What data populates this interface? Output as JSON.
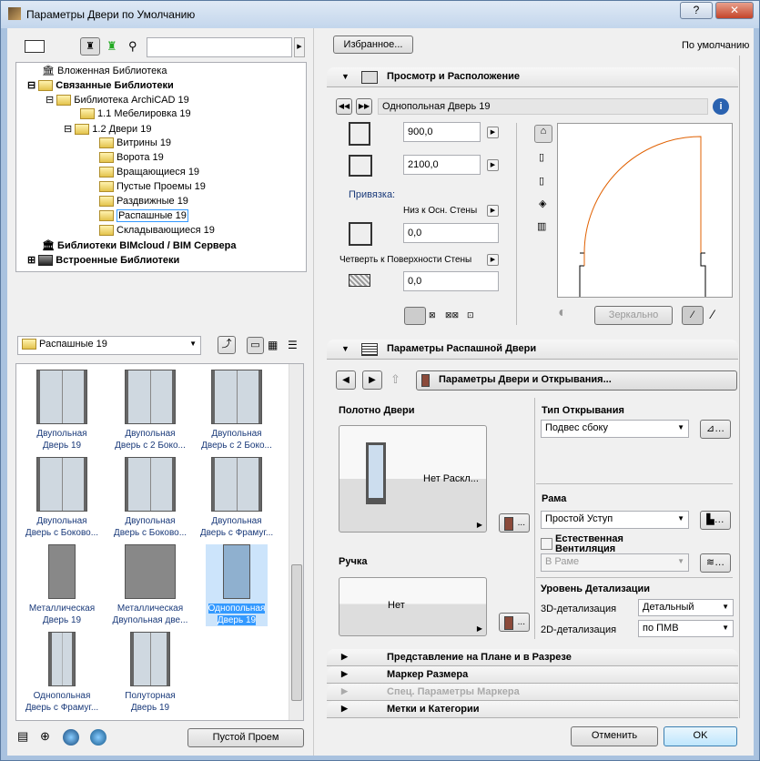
{
  "window": {
    "title": "Параметры Двери по Умолчанию",
    "help": "?",
    "close": "✕"
  },
  "left": {
    "tree": [
      {
        "label": "Вложенная Библиотека",
        "bold": false
      },
      {
        "label": "Связанные Библиотеки",
        "bold": true
      },
      {
        "label": "Библиотека ArchiCAD 19",
        "bold": false
      },
      {
        "label": "1.1 Мебелировка 19",
        "bold": false
      },
      {
        "label": "1.2 Двери 19",
        "bold": false
      },
      {
        "label": "Витрины 19",
        "bold": false
      },
      {
        "label": "Ворота 19",
        "bold": false
      },
      {
        "label": "Вращающиеся 19",
        "bold": false
      },
      {
        "label": "Пустые Проемы 19",
        "bold": false
      },
      {
        "label": "Раздвижные 19",
        "bold": false
      },
      {
        "label": "Распашные 19",
        "bold": false,
        "selected": true
      },
      {
        "label": "Складывающиеся 19",
        "bold": false
      },
      {
        "label": "Библиотеки BIMcloud / BIM Сервера",
        "bold": true
      },
      {
        "label": "Встроенные Библиотеки",
        "bold": true
      }
    ],
    "folder_select": "Распашные 19",
    "items": [
      {
        "l1": "Двупольная",
        "l2": "Дверь 19"
      },
      {
        "l1": "Двупольная",
        "l2": "Дверь с 2 Боко..."
      },
      {
        "l1": "Двупольная",
        "l2": "Дверь с 2 Боко..."
      },
      {
        "l1": "Двупольная",
        "l2": "Дверь с Боково..."
      },
      {
        "l1": "Двупольная",
        "l2": "Дверь с Боково..."
      },
      {
        "l1": "Двупольная",
        "l2": "Дверь с Фрамуг..."
      },
      {
        "l1": "Металлическая",
        "l2": "Дверь 19"
      },
      {
        "l1": "Металлическая",
        "l2": "Двупольная две..."
      },
      {
        "l1": "Однопольная",
        "l2": "Дверь 19",
        "selected": true
      },
      {
        "l1": "Однопольная",
        "l2": "Дверь с Фрамуг..."
      },
      {
        "l1": "Полуторная",
        "l2": "Дверь 19"
      }
    ],
    "empty_opening_button": "Пустой Проем"
  },
  "right": {
    "favorites_button": "Избранное...",
    "default_label": "По умолчанию",
    "section1": {
      "title": "Просмотр и Расположение",
      "object_name": "Однопольная Дверь 19",
      "width": "900,0",
      "height": "2100,0",
      "anchor_label": "Привязка:",
      "anchor_mode": "Низ к Осн. Стены",
      "sill": "0,0",
      "reveal_mode": "Четверть к Поверхности Стены",
      "reveal": "0,0",
      "mirror_button": "Зеркально"
    },
    "section2": {
      "title": "Параметры Распашной Двери",
      "page_button": "Параметры Двери и Открывания...",
      "leaf_title": "Полотно Двери",
      "leaf_value": "Нет Раскл...",
      "opening_title": "Тип Открывания",
      "opening_value": "Подвес сбоку",
      "frame_title": "Рама",
      "frame_value": "Простой Уступ",
      "vent_label": "Естественная Вентиляция",
      "vent_value": "В Раме",
      "handle_title": "Ручка",
      "handle_value": "Нет",
      "detail_title": "Уровень Детализации",
      "d3_label": "3D-детализация",
      "d3_value": "Детальный",
      "d2_label": "2D-детализация",
      "d2_value": "по ПМВ"
    },
    "collapsed": [
      "Представление на Плане и в Разрезе",
      "Маркер Размера",
      "Спец. Параметры Маркера",
      "Метки и Категории"
    ],
    "cancel": "Отменить",
    "ok": "OK"
  },
  "colors": {
    "accent": "#3399ff",
    "door_swing": "#e06000"
  }
}
